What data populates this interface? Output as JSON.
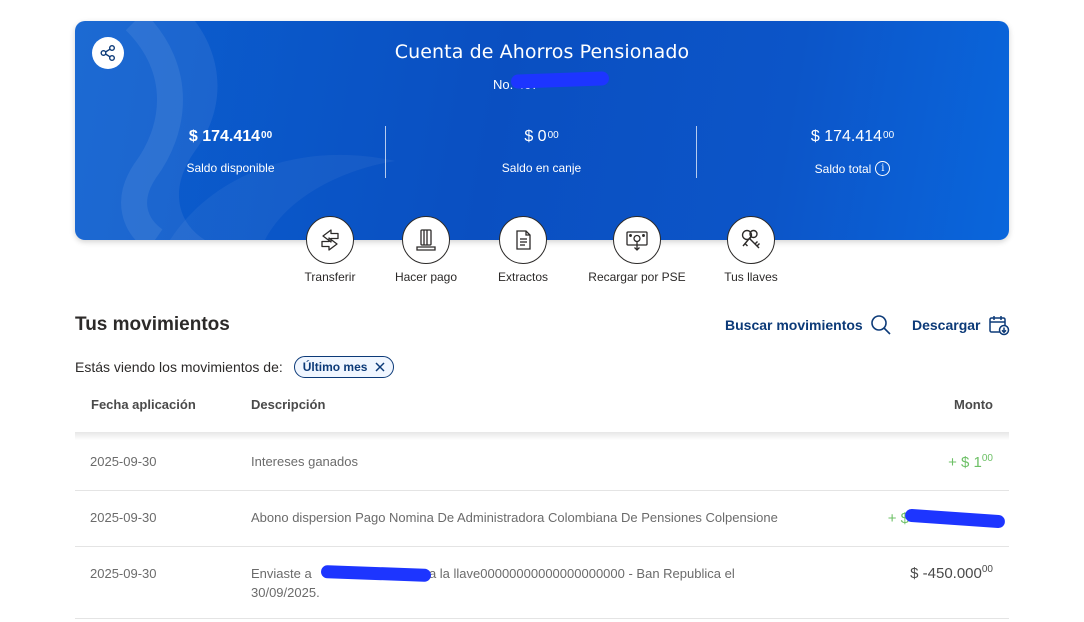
{
  "account": {
    "title": "Cuenta de Ahorros Pensionado",
    "number_label": "No. 407"
  },
  "balances": [
    {
      "amount": "$ 174.414",
      "cents": "00",
      "label": "Saldo disponible"
    },
    {
      "amount": "$ 0",
      "cents": "00",
      "label": "Saldo en canje"
    },
    {
      "amount": "$ 174.414",
      "cents": "00",
      "label": "Saldo total"
    }
  ],
  "info_icon_glyph": "i",
  "actions": [
    {
      "label": "Transferir",
      "icon": "transfer-arrows-icon"
    },
    {
      "label": "Hacer pago",
      "icon": "payment-card-icon"
    },
    {
      "label": "Extractos",
      "icon": "document-icon"
    },
    {
      "label": "Recargar por PSE",
      "icon": "pse-recharge-icon"
    },
    {
      "label": "Tus llaves",
      "icon": "keys-icon"
    }
  ],
  "movements": {
    "title": "Tus movimientos",
    "search_label": "Buscar movimientos",
    "download_label": "Descargar",
    "filter_text": "Estás viendo los movimientos de:",
    "filter_chip": "Último mes",
    "columns": {
      "date": "Fecha aplicación",
      "description": "Descripción",
      "amount": "Monto"
    },
    "rows": [
      {
        "date": "2025-09-30",
        "description": "Intereses ganados",
        "amount": "+ $ 1",
        "cents": "00",
        "sign": "positive"
      },
      {
        "date": "2025-09-30",
        "description": "Abono dispersion Pago Nomina De Administradora Colombiana De Pensiones Colpensione",
        "amount": "+ $",
        "cents": "",
        "sign": "positive"
      },
      {
        "date": "2025-09-30",
        "description_line1": "Enviaste a",
        "description_line1b": "a la llave00000000000000000000 - Ban Republica el",
        "description_line2": "30/09/2025.",
        "amount": "$ -450.000",
        "cents": "00",
        "sign": "negative"
      }
    ]
  },
  "colors": {
    "card_blue": "#0a4fc1",
    "navy_text": "#0c3a78",
    "positive_green": "#6dc066",
    "redaction_blue": "#1d35ff"
  }
}
